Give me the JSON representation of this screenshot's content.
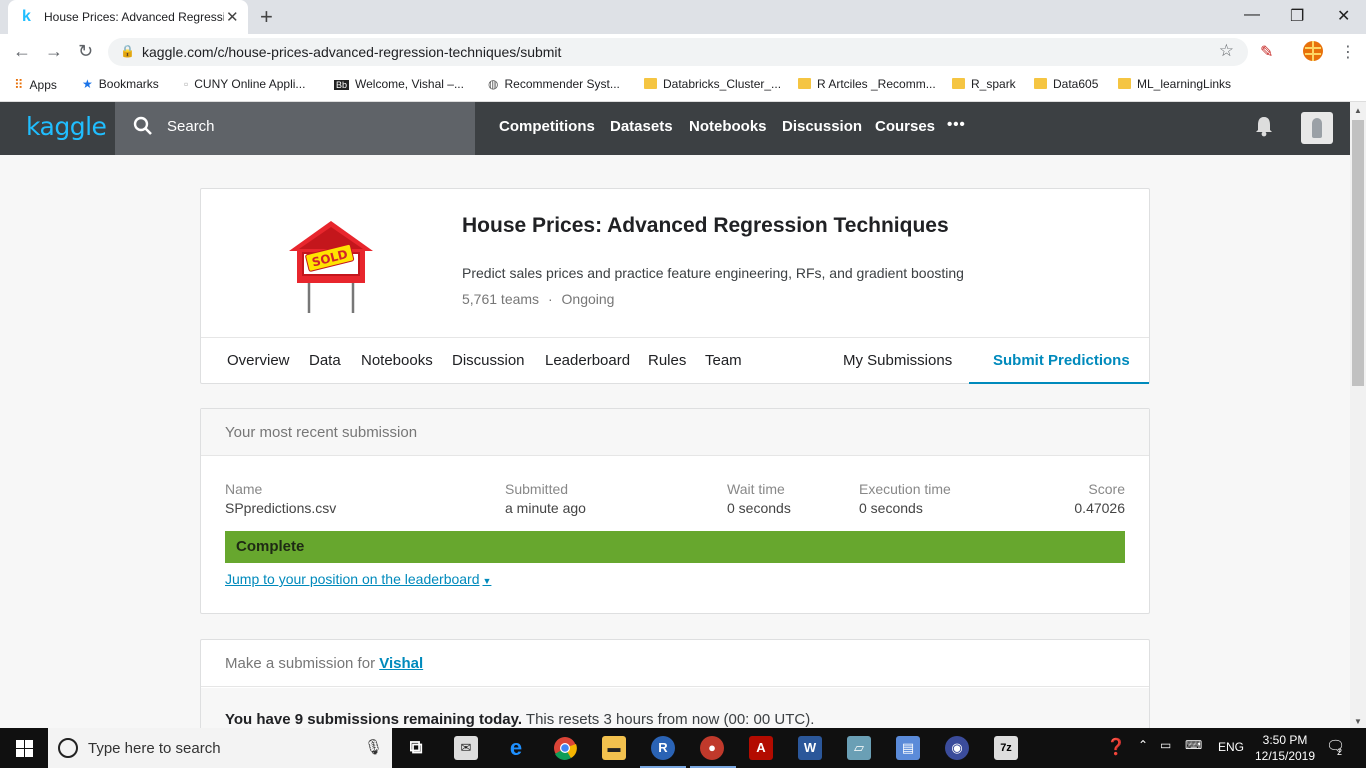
{
  "browser": {
    "tab_title": "House Prices: Advanced Regressi",
    "tab_favicon": "k",
    "url": "kaggle.com/c/house-prices-advanced-regression-techniques/submit",
    "bookmarks": [
      {
        "label": "Apps",
        "icon": "apps-grid-icon"
      },
      {
        "label": "Bookmarks",
        "icon": "star-icon"
      },
      {
        "label": "CUNY Online Appli...",
        "icon": "page-icon"
      },
      {
        "label": "Welcome, Vishal –...",
        "icon": "bb-icon"
      },
      {
        "label": "Recommender Syst...",
        "icon": "globe-icon"
      },
      {
        "label": "Databricks_Cluster_...",
        "icon": "folder-icon"
      },
      {
        "label": "R Artciles _Recomm...",
        "icon": "folder-icon"
      },
      {
        "label": "R_spark",
        "icon": "folder-icon"
      },
      {
        "label": "Data605",
        "icon": "folder-icon"
      },
      {
        "label": "ML_learningLinks",
        "icon": "folder-icon"
      }
    ]
  },
  "kaggle_nav": {
    "logo": "kaggle",
    "search_label": "Search",
    "menu": [
      "Competitions",
      "Datasets",
      "Notebooks",
      "Discussion",
      "Courses"
    ],
    "more": "•••"
  },
  "competition": {
    "title": "House Prices: Advanced Regression Techniques",
    "description": "Predict sales prices and practice feature engineering, RFs, and gradient boosting",
    "teams": "5,761 teams",
    "separator": "·",
    "status": "Ongoing",
    "sign_text": "SOLD",
    "tabs": [
      "Overview",
      "Data",
      "Notebooks",
      "Discussion",
      "Leaderboard",
      "Rules",
      "Team"
    ],
    "right_tabs": [
      "My Submissions",
      "Submit Predictions"
    ]
  },
  "recent_submission": {
    "heading": "Your most recent submission",
    "columns": {
      "name": {
        "header": "Name",
        "value": "SPpredictions.csv"
      },
      "submitted": {
        "header": "Submitted",
        "value": "a minute ago"
      },
      "wait": {
        "header": "Wait time",
        "value": "0 seconds"
      },
      "execution": {
        "header": "Execution time",
        "value": "0 seconds"
      },
      "score": {
        "header": "Score",
        "value": "0.47026"
      }
    },
    "status": "Complete",
    "status_color": "#67a72e",
    "jump_link": "Jump to your position on the leaderboard"
  },
  "make_submission": {
    "heading_prefix": "Make a submission for",
    "user": "Vishal",
    "remaining_bold": "You have 9 submissions remaining today.",
    "remaining_rest": " This resets 3 hours from now (00: 00 UTC)."
  },
  "taskbar": {
    "search_placeholder": "Type here to search",
    "language": "ENG",
    "time": "3:50 PM",
    "date": "12/15/2019",
    "notification_count": "2"
  }
}
